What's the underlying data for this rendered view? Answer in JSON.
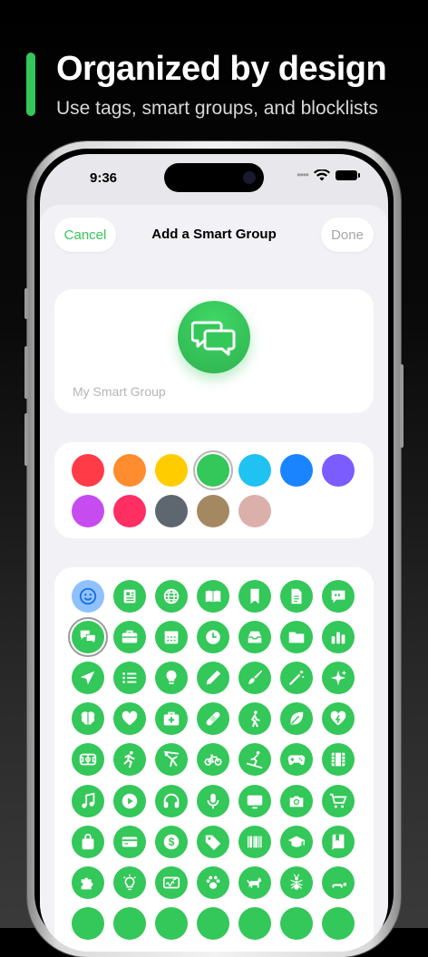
{
  "promo": {
    "title": "Organized by design",
    "subtitle": "Use tags, smart groups, and blocklists",
    "accent_color": "#34c759"
  },
  "status_bar": {
    "time": "9:36",
    "signal_icon": "signal-dots-icon",
    "wifi_icon": "wifi-icon",
    "battery_icon": "battery-icon"
  },
  "nav": {
    "cancel_label": "Cancel",
    "title": "Add a Smart Group",
    "done_label": "Done"
  },
  "group": {
    "icon": "message-bubbles-icon",
    "name_value": "",
    "name_placeholder": "My Smart Group"
  },
  "colors": {
    "selected_index": 3,
    "swatches": [
      "#ff3b47",
      "#ff8c2e",
      "#ffcc00",
      "#34c759",
      "#1fc2f0",
      "#1a84ff",
      "#7b5cff",
      "#c64cf0",
      "#ff2e63",
      "#5e6670",
      "#a48862",
      "#dcb0aa"
    ]
  },
  "icons": {
    "selected": "message-bubbles-icon",
    "items": [
      "smiley-icon",
      "newspaper-icon",
      "globe-icon",
      "book-icon",
      "bookmark-icon",
      "document-icon",
      "quote-bubble-icon",
      "message-bubbles-icon",
      "briefcase-icon",
      "calendar-icon",
      "clock-icon",
      "tray-icon",
      "folder-icon",
      "chart-icon",
      "paper-plane-icon",
      "list-icon",
      "lightbulb-icon",
      "pencil-icon",
      "paintbrush-icon",
      "magic-wand-icon",
      "sparkles-icon",
      "brain-icon",
      "heart-icon",
      "first-aid-icon",
      "bandage-icon",
      "walking-icon",
      "leaf-icon",
      "heart-bolt-icon",
      "stadium-icon",
      "running-icon",
      "gymnastics-icon",
      "bicycle-icon",
      "skiing-icon",
      "gamepad-icon",
      "film-icon",
      "music-note-icon",
      "play-icon",
      "headphones-icon",
      "microphone-icon",
      "tv-icon",
      "camera-icon",
      "cart-icon",
      "shopping-bag-icon",
      "credit-card-icon",
      "dollar-icon",
      "tag-icon",
      "barcode-icon",
      "graduation-cap-icon",
      "closed-book-icon",
      "puzzle-icon",
      "bulb-idea-icon",
      "signature-icon",
      "paw-icon",
      "dog-icon",
      "ant-icon",
      "tortoise-icon",
      "partial-icon-1",
      "partial-icon-2",
      "partial-icon-3",
      "partial-icon-4",
      "partial-icon-5",
      "partial-icon-6",
      "partial-icon-7"
    ]
  }
}
